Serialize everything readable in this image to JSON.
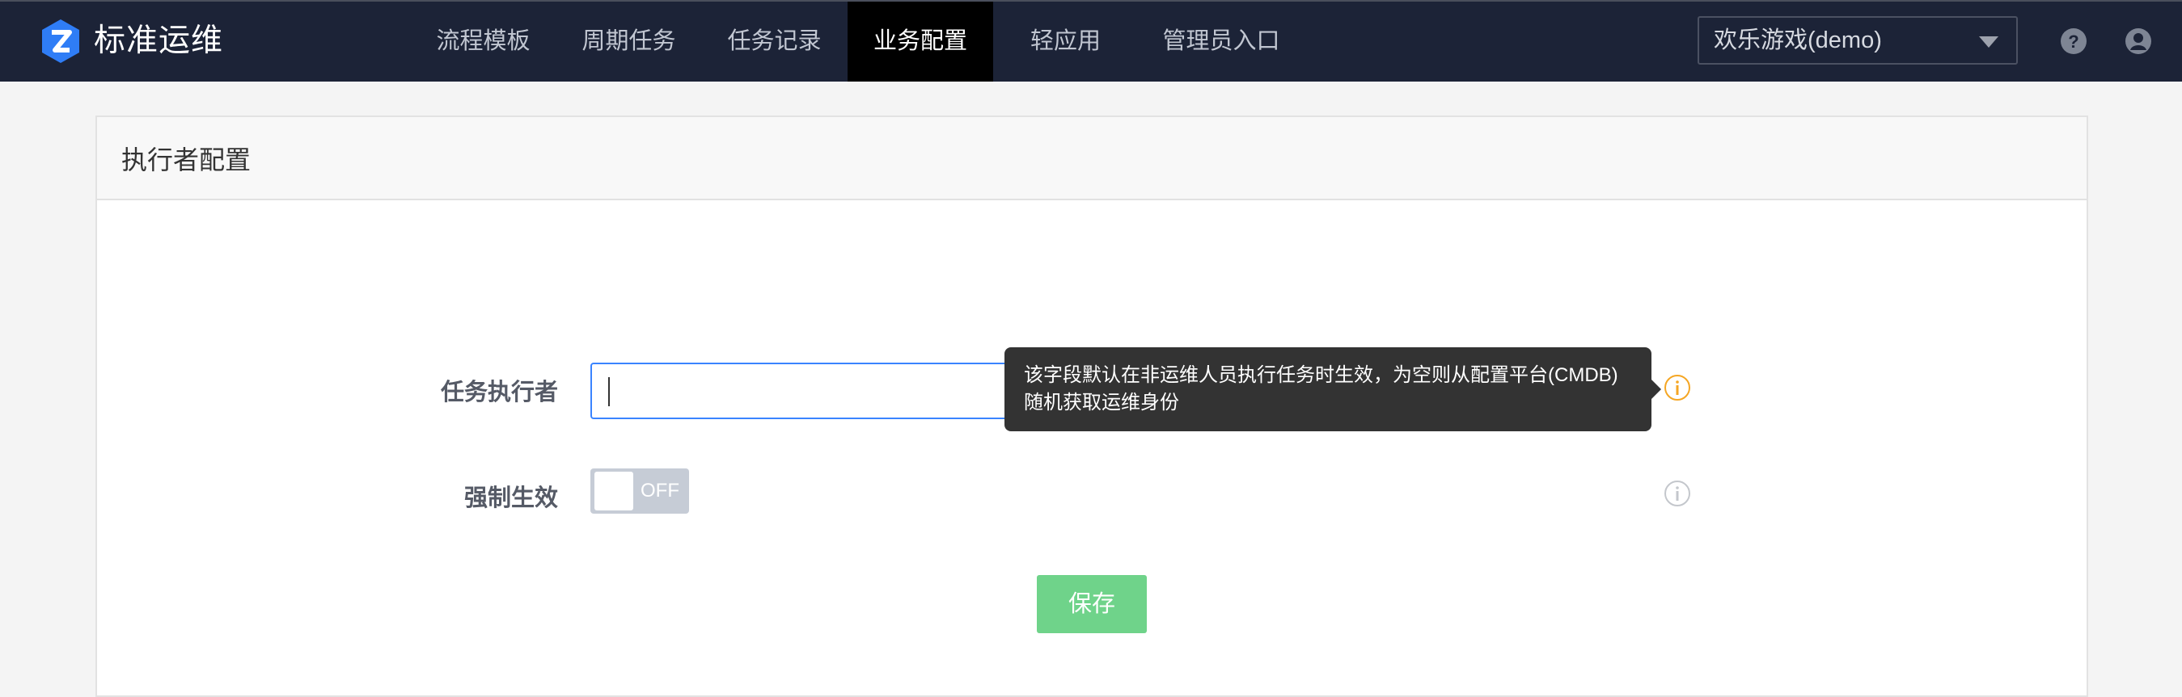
{
  "header": {
    "brand": "标准运维",
    "nav": [
      "流程模板",
      "周期任务",
      "任务记录",
      "业务配置",
      "轻应用",
      "管理员入口"
    ],
    "active_nav": "业务配置",
    "business_selector": "欢乐游戏(demo)",
    "icons": [
      "help-icon",
      "user-icon"
    ]
  },
  "panel": {
    "title": "执行者配置"
  },
  "form": {
    "executor_label": "任务执行者",
    "executor_value": "",
    "executor_tooltip": "该字段默认在非运维人员执行任务时生效，为空则从配置平台(CMDB)随机获取运维身份",
    "force_label": "强制生效",
    "force_toggle_text": "OFF",
    "save_label": "保存"
  },
  "colors": {
    "header_bg": "#1c2337",
    "primary_blue": "#3a84ff",
    "save_green": "#6fd38a",
    "info_orange": "#f5a623"
  }
}
